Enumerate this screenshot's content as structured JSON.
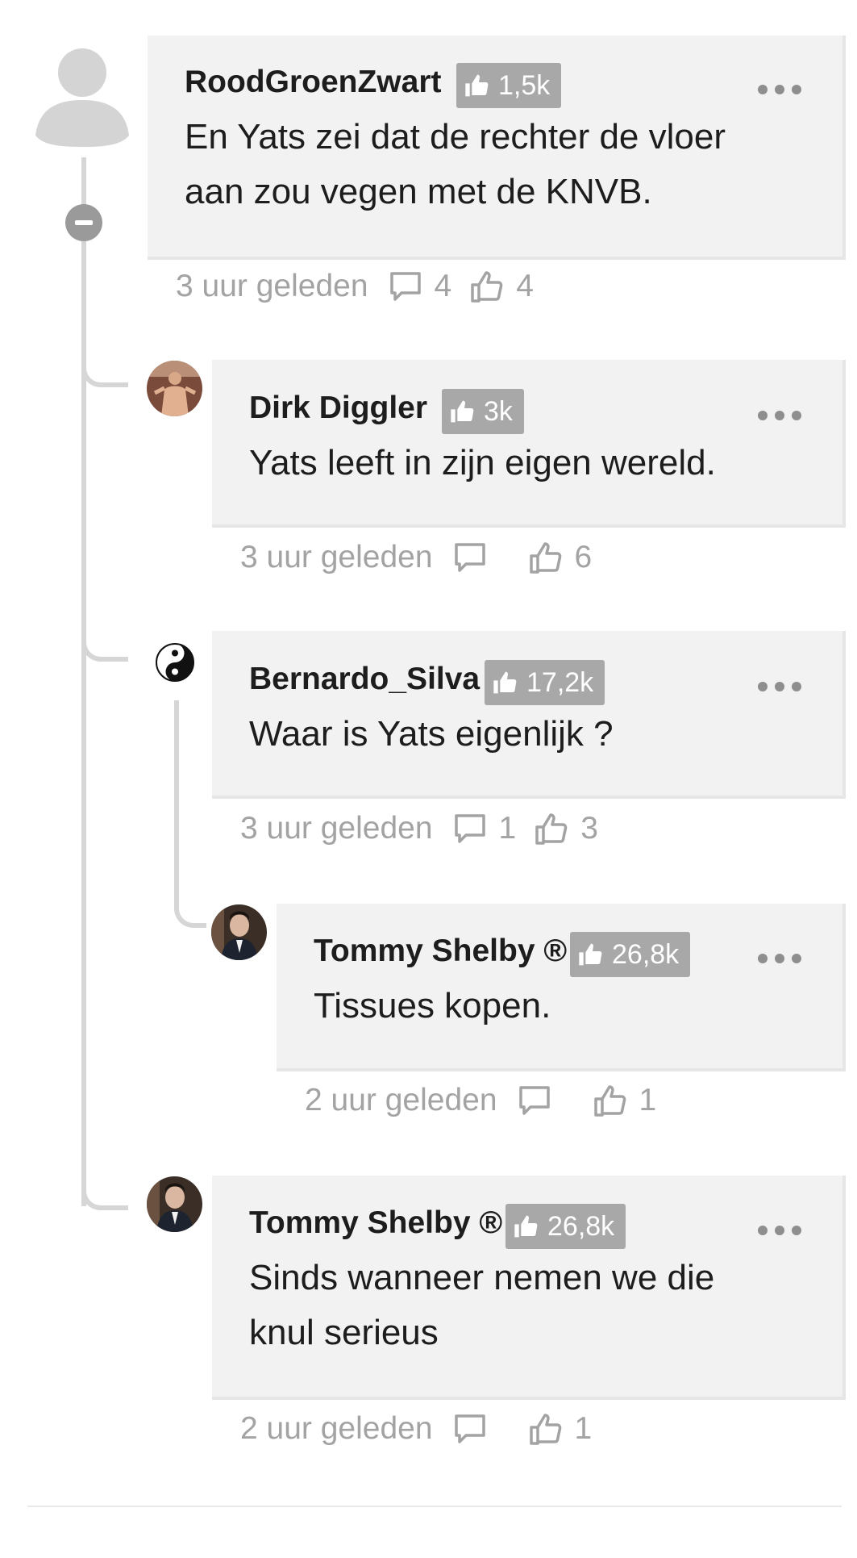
{
  "comments": [
    {
      "user": "RoodGroenZwart",
      "badge": "1,5k",
      "text_lines": [
        "En Yats zei dat de rechter de vloer",
        "aan zou vegen met de KNVB."
      ],
      "time": "3 uur geleden",
      "replies": "4",
      "likes": "4"
    },
    {
      "user": "Dirk Diggler",
      "badge": "3k",
      "text_lines": [
        "Yats leeft in zijn eigen wereld."
      ],
      "time": "3 uur geleden",
      "replies": "",
      "likes": "6"
    },
    {
      "user": "Bernardo_Silva",
      "badge": "17,2k",
      "text_lines": [
        "Waar is Yats eigenlijk ?"
      ],
      "time": "3 uur geleden",
      "replies": "1",
      "likes": "3"
    },
    {
      "user": "Tommy Shelby ®",
      "badge": "26,8k",
      "text_lines": [
        "Tissues kopen."
      ],
      "time": "2 uur geleden",
      "replies": "",
      "likes": "1"
    },
    {
      "user": "Tommy Shelby ®",
      "badge": "26,8k",
      "text_lines": [
        "Sinds wanneer nemen we die",
        "knul serieus"
      ],
      "time": "2 uur geleden",
      "replies": "",
      "likes": "1"
    }
  ],
  "icons": {
    "collapse": "collapse-minus-icon",
    "menu": "more-dots-icon",
    "reply": "reply-bubble-icon",
    "like": "thumbs-up-icon"
  },
  "colors": {
    "card": "#f2f2f2",
    "badge": "#a8a8a8",
    "meta": "#a3a3a3",
    "thread": "#d6d6d6"
  }
}
